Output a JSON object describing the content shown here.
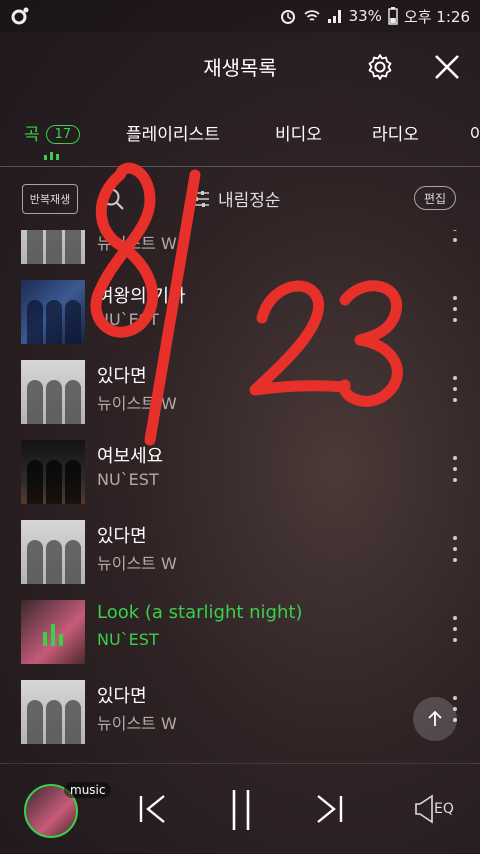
{
  "status": {
    "battery": "33%",
    "time": "오후 1:26"
  },
  "header": {
    "title": "재생목록"
  },
  "tabs": [
    {
      "label": "곡",
      "count": "17",
      "active": true
    },
    {
      "label": "플레이리스트"
    },
    {
      "label": "비디오"
    },
    {
      "label": "라디오"
    },
    {
      "label": "아"
    }
  ],
  "toolbar": {
    "repeat_label": "반복재생",
    "sort_label": "내림정순",
    "edit_label": "편집"
  },
  "songs": [
    {
      "title": "",
      "artist": "뉴이스트 W"
    },
    {
      "title": "여왕의 기사",
      "artist": "NU`EST"
    },
    {
      "title": "있다면",
      "artist": "뉴이스트 W"
    },
    {
      "title": "여보세요",
      "artist": "NU`EST"
    },
    {
      "title": "있다면",
      "artist": "뉴이스트 W"
    },
    {
      "title": "Look (a starlight night)",
      "artist": "NU`EST",
      "playing": true
    },
    {
      "title": "있다면",
      "artist": "뉴이스트 W"
    }
  ],
  "player": {
    "source_badge": "music",
    "eq_label": "EQ"
  },
  "annotation": {
    "text": "8/23",
    "color": "#e8302a"
  },
  "colors": {
    "accent": "#39d04a"
  }
}
